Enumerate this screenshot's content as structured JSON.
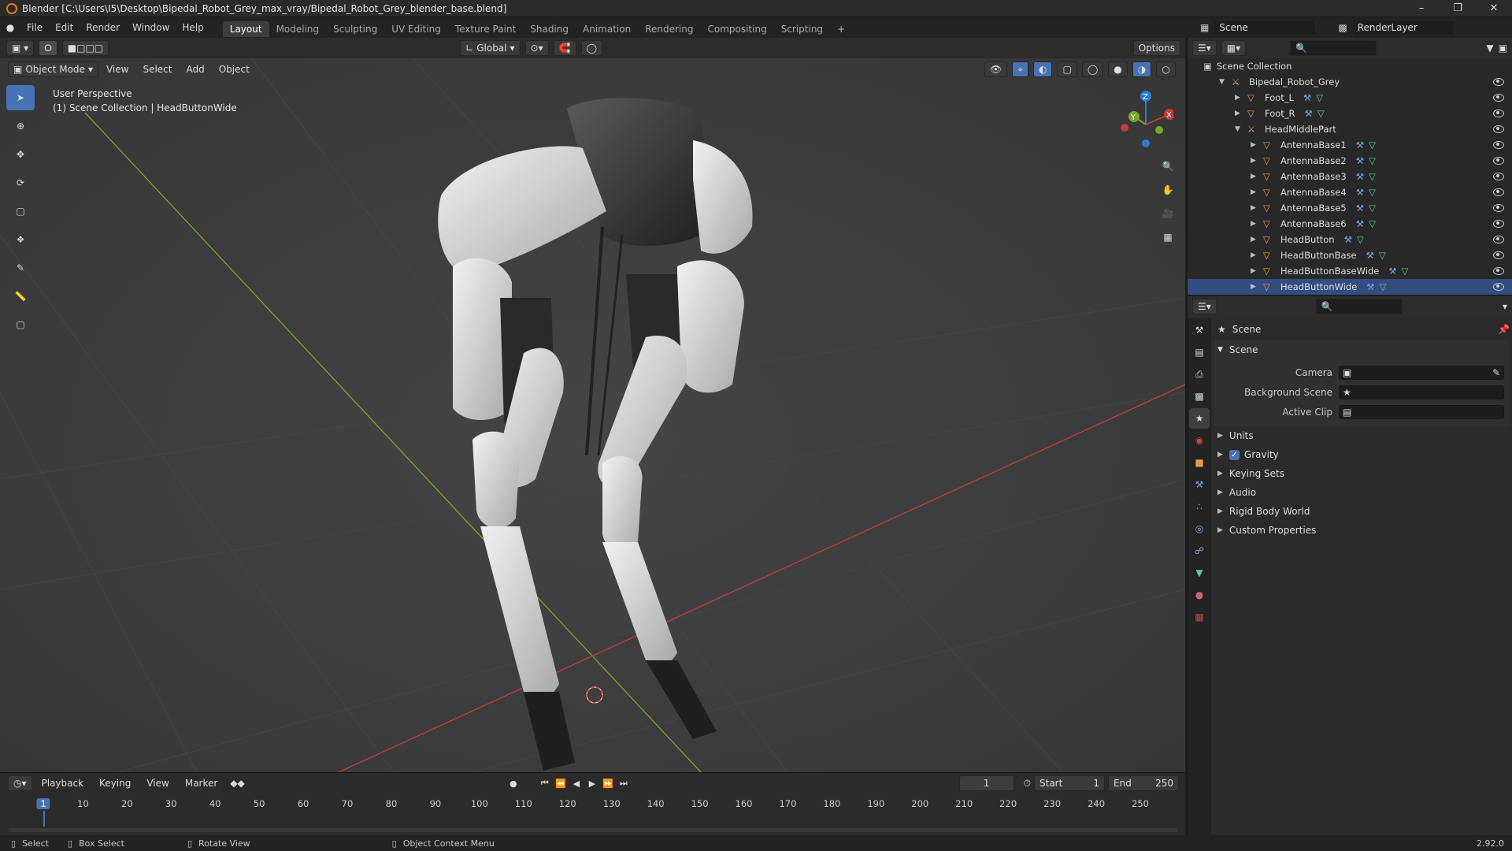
{
  "title": "Blender [C:\\Users\\I5\\Desktop\\Bipedal_Robot_Grey_max_vray/Bipedal_Robot_Grey_blender_base.blend]",
  "menus": [
    "File",
    "Edit",
    "Render",
    "Window",
    "Help"
  ],
  "workspaces": [
    "Layout",
    "Modeling",
    "Sculpting",
    "UV Editing",
    "Texture Paint",
    "Shading",
    "Animation",
    "Rendering",
    "Compositing",
    "Scripting"
  ],
  "scene_name": "Scene",
  "render_layer": "RenderLayer",
  "viewport": {
    "mode": "Object Mode",
    "menu": [
      "View",
      "Select",
      "Add",
      "Object"
    ],
    "transform": "Global",
    "options": "Options",
    "overlay_line1": "User Perspective",
    "overlay_line2": "(1) Scene Collection | HeadButtonWide"
  },
  "outliner": {
    "root": "Scene Collection",
    "items": [
      {
        "label": "Bipedal_Robot_Grey",
        "level": 1,
        "expanded": true,
        "type": "armature"
      },
      {
        "label": "Foot_L",
        "level": 2,
        "expanded": false,
        "type": "mesh"
      },
      {
        "label": "Foot_R",
        "level": 2,
        "expanded": false,
        "type": "mesh"
      },
      {
        "label": "HeadMiddlePart",
        "level": 2,
        "expanded": true,
        "type": "armature"
      },
      {
        "label": "AntennaBase1",
        "level": 3,
        "expanded": false,
        "type": "mesh"
      },
      {
        "label": "AntennaBase2",
        "level": 3,
        "expanded": false,
        "type": "mesh"
      },
      {
        "label": "AntennaBase3",
        "level": 3,
        "expanded": false,
        "type": "mesh"
      },
      {
        "label": "AntennaBase4",
        "level": 3,
        "expanded": false,
        "type": "mesh"
      },
      {
        "label": "AntennaBase5",
        "level": 3,
        "expanded": false,
        "type": "mesh"
      },
      {
        "label": "AntennaBase6",
        "level": 3,
        "expanded": false,
        "type": "mesh"
      },
      {
        "label": "HeadButton",
        "level": 3,
        "expanded": false,
        "type": "mesh"
      },
      {
        "label": "HeadButtonBase",
        "level": 3,
        "expanded": false,
        "type": "mesh"
      },
      {
        "label": "HeadButtonBaseWide",
        "level": 3,
        "expanded": false,
        "type": "mesh"
      },
      {
        "label": "HeadButtonWide",
        "level": 3,
        "expanded": false,
        "type": "mesh"
      }
    ]
  },
  "properties": {
    "context": "Scene",
    "section": "Scene",
    "fields": [
      {
        "label": "Camera"
      },
      {
        "label": "Background Scene"
      },
      {
        "label": "Active Clip"
      }
    ],
    "panels": [
      "Units",
      "Gravity",
      "Keying Sets",
      "Audio",
      "Rigid Body World",
      "Custom Properties"
    ],
    "gravity_checked": true
  },
  "timeline": {
    "menus": [
      "Playback",
      "Keying",
      "View",
      "Marker"
    ],
    "current_frame": "1",
    "start_label": "Start",
    "start": "1",
    "end_label": "End",
    "end": "250",
    "ticks": [
      "1",
      "10",
      "20",
      "30",
      "40",
      "50",
      "60",
      "70",
      "80",
      "90",
      "100",
      "110",
      "120",
      "130",
      "140",
      "150",
      "160",
      "170",
      "180",
      "190",
      "200",
      "210",
      "220",
      "230",
      "240",
      "250"
    ]
  },
  "status": {
    "select": "Select",
    "box_select": "Box Select",
    "rotate": "Rotate View",
    "context_menu": "Object Context Menu",
    "version": "2.92.0"
  },
  "colors": {
    "accent": "#4772b3",
    "x_axis": "#c43c3c",
    "y_axis": "#7aa52a",
    "z_axis": "#2e7bd6",
    "mesh_icon": "#e39c4a",
    "modifier_icon": "#6aa5e6",
    "data_icon": "#5fcf7a"
  }
}
